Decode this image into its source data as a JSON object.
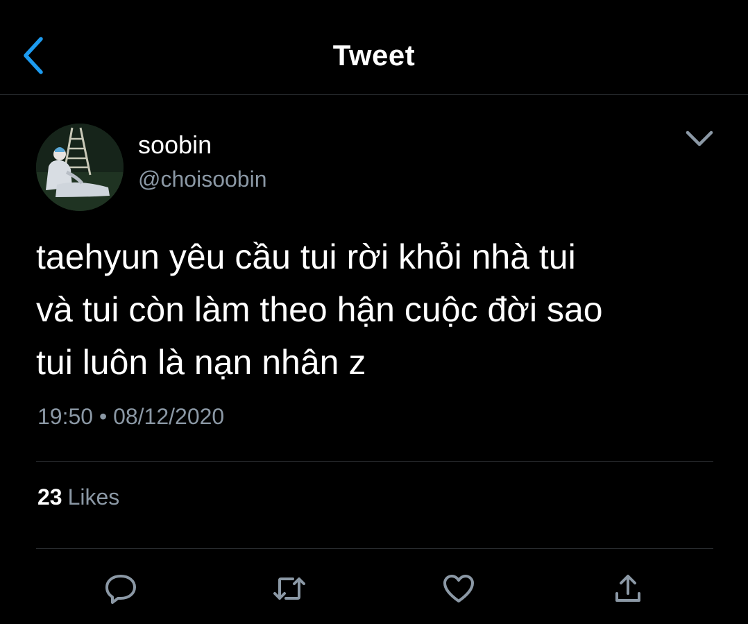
{
  "header": {
    "title": "Tweet",
    "back_icon": "chevron-left-icon",
    "accent_color": "#1d9bf0"
  },
  "tweet": {
    "author": {
      "display_name": "soobin",
      "handle": "@choisoobin"
    },
    "text_lines": [
      "taehyun yêu cầu tui rời khỏi nhà tui",
      "và tui còn làm theo hận cuộc đời sao",
      "tui luôn là nạn nhân z"
    ],
    "time": "19:50",
    "separator": "•",
    "date": "08/12/2020"
  },
  "stats": {
    "likes_count": "23",
    "likes_label": "Likes"
  },
  "actions": [
    "reply-icon",
    "retweet-icon",
    "like-icon",
    "share-icon"
  ],
  "colors": {
    "background": "#000000",
    "text": "#ffffff",
    "secondary": "#8b98a5",
    "divider": "#2f3336"
  }
}
